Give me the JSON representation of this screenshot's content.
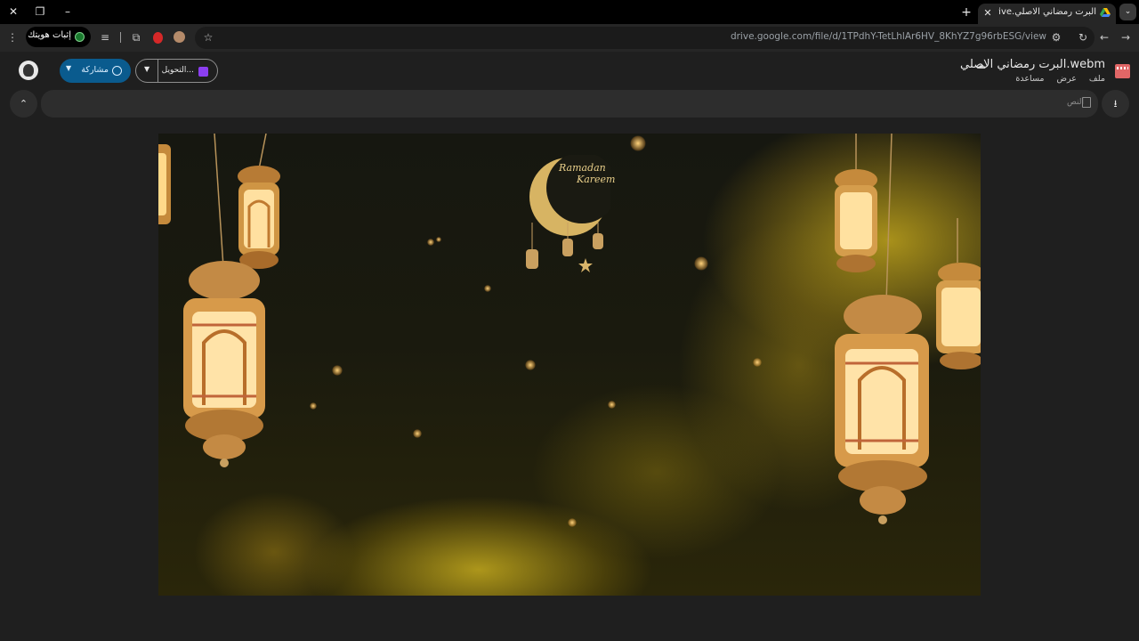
{
  "browser": {
    "tab": {
      "title": "البرت رمضاني الاصلي.webm - Google Drive",
      "close": "✕"
    },
    "new_tab": "+",
    "window_controls": {
      "close": "✕",
      "restore": "❐",
      "minimize": "–"
    },
    "url": "drive.google.com/file/d/1TPdhY-TetLhlAr6HV_8KhYZ7g96rbESG/view",
    "url_host": "drive.google.com",
    "url_path": "/file/d/1TPdhY-TetLhlAr6HV_8KhYZ7g96rbESG/view",
    "verify_identity": "إثبات هويتك"
  },
  "drive": {
    "file_title": "البرت رمضاني الاصلي.webm",
    "menu": [
      "ملف",
      "عرض",
      "مساعدة"
    ],
    "share_label": "مشاركة",
    "open_with_label": "التحويل...",
    "search_placeholder": "النص"
  },
  "video": {
    "overlay_text_line1": "Ramadan",
    "overlay_text_line2": "Kareem"
  },
  "colors": {
    "accent_share": "#0a5b8e",
    "gold": "#e9cf8a",
    "file_icon": "#e06666"
  }
}
